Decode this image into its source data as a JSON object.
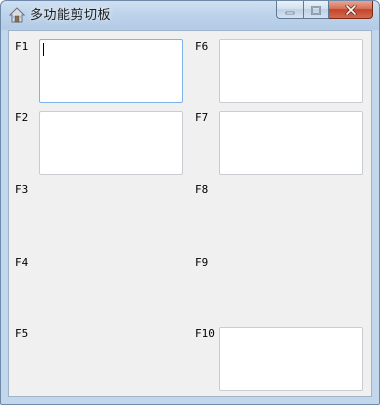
{
  "window": {
    "title": "多功能剪切板",
    "app_icon": "house-icon",
    "minimize_icon": "minimize-icon",
    "maximize_icon": "maximize-icon",
    "close_icon": "close-icon",
    "close_color": "#c7452b"
  },
  "fields": [
    {
      "label": "F1",
      "value": "",
      "has_box": true,
      "focused": true
    },
    {
      "label": "F2",
      "value": "",
      "has_box": true,
      "focused": false
    },
    {
      "label": "F3",
      "value": "",
      "has_box": false,
      "focused": false
    },
    {
      "label": "F4",
      "value": "",
      "has_box": false,
      "focused": false
    },
    {
      "label": "F5",
      "value": "",
      "has_box": false,
      "focused": false
    },
    {
      "label": "F6",
      "value": "",
      "has_box": true,
      "focused": false
    },
    {
      "label": "F7",
      "value": "",
      "has_box": true,
      "focused": false
    },
    {
      "label": "F8",
      "value": "",
      "has_box": false,
      "focused": false
    },
    {
      "label": "F9",
      "value": "",
      "has_box": false,
      "focused": false
    },
    {
      "label": "F10",
      "value": "",
      "has_box": true,
      "focused": false
    }
  ]
}
